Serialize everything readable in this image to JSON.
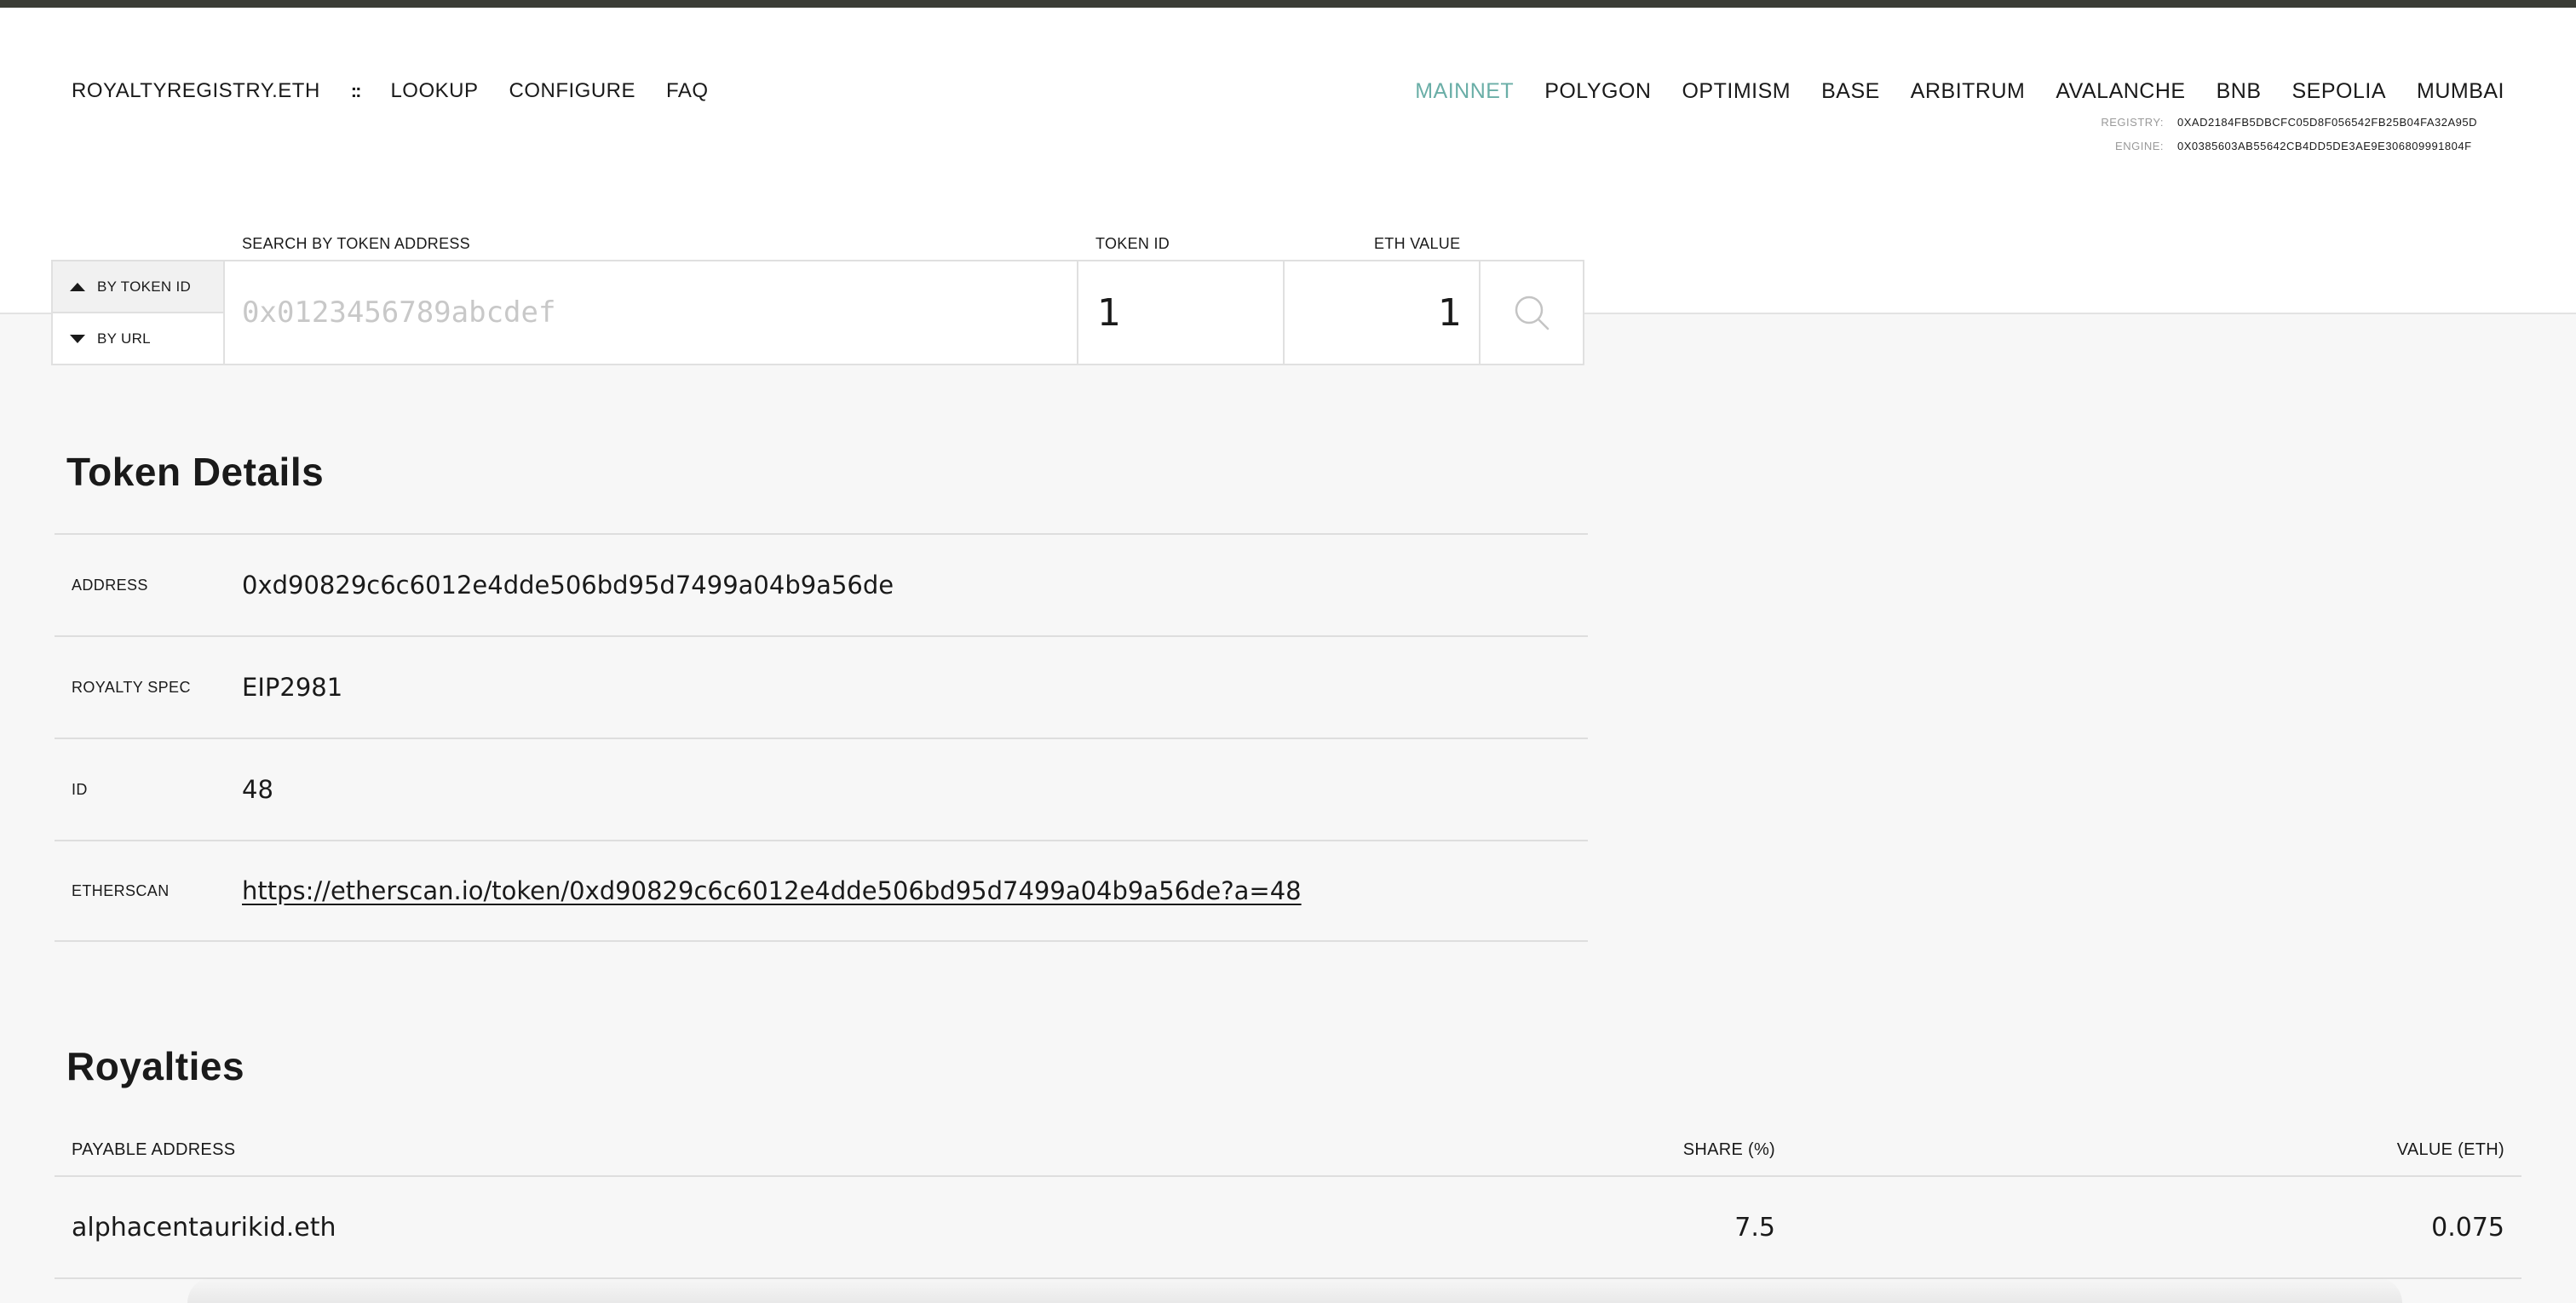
{
  "nav": {
    "brand": "ROYALTYREGISTRY.ETH",
    "grid_icon": "::",
    "links": [
      "LOOKUP",
      "CONFIGURE",
      "FAQ"
    ]
  },
  "networks": [
    "MAINNET",
    "POLYGON",
    "OPTIMISM",
    "BASE",
    "ARBITRUM",
    "AVALANCHE",
    "BNB",
    "SEPOLIA",
    "MUMBAI"
  ],
  "active_network": "MAINNET",
  "accent_color": "#6aaea7",
  "contracts": {
    "registry_label": "REGISTRY:",
    "registry_value": "0XAD2184FB5DBCFC05D8F056542FB25B04FA32A95D",
    "engine_label": "ENGINE:",
    "engine_value": "0X0385603AB55642CB4DD5DE3AE9E306809991804F"
  },
  "search": {
    "address_label": "SEARCH BY TOKEN ADDRESS",
    "token_id_label": "TOKEN ID",
    "eth_value_label": "ETH VALUE",
    "mode_token": "BY TOKEN ID",
    "mode_url": "BY URL",
    "address_placeholder": "0x0123456789abcdef",
    "token_id_value": "1",
    "eth_value": "1",
    "search_icon": "search-icon"
  },
  "token_details": {
    "title": "Token Details",
    "rows": [
      {
        "label": "ADDRESS",
        "value": "0xd90829c6c6012e4dde506bd95d7499a04b9a56de"
      },
      {
        "label": "ROYALTY SPEC",
        "value": "EIP2981"
      },
      {
        "label": "ID",
        "value": "48"
      },
      {
        "label": "ETHERSCAN",
        "value": "https://etherscan.io/token/0xd90829c6c6012e4dde506bd95d7499a04b9a56de?a=48"
      }
    ]
  },
  "royalties": {
    "title": "Royalties",
    "columns": [
      "PAYABLE ADDRESS",
      "SHARE (%)",
      "VALUE (ETH)"
    ],
    "rows": [
      {
        "address": "alphacentaurikid.eth",
        "share": "7.5",
        "value": "0.075"
      }
    ]
  }
}
